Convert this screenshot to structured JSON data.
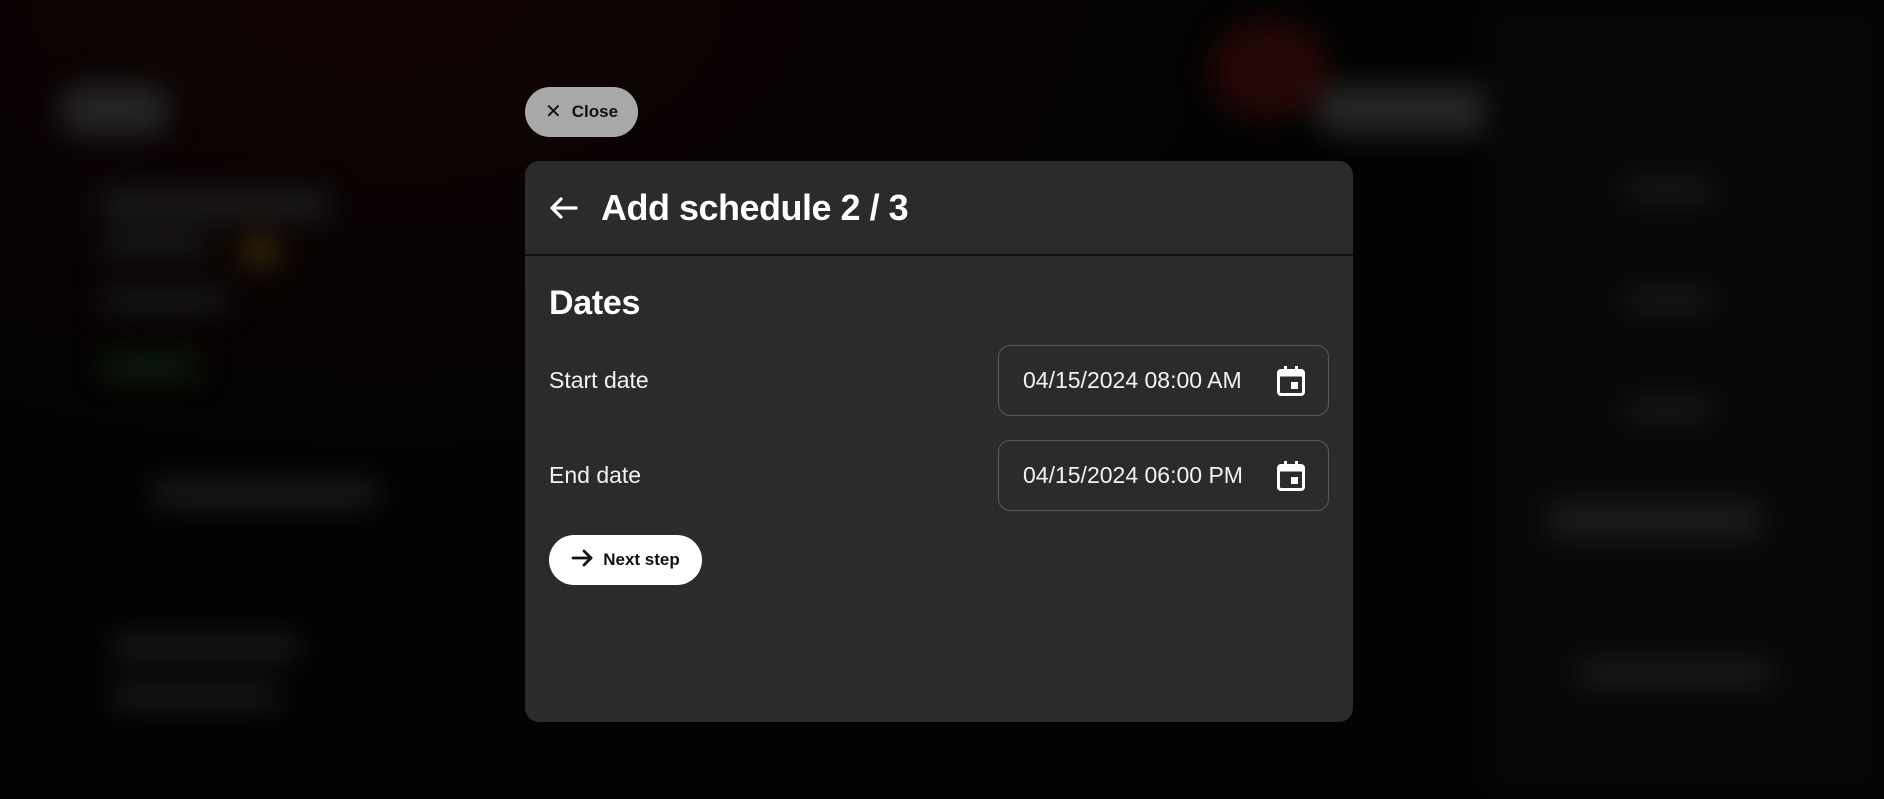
{
  "close_button": {
    "label": "Close",
    "icon": "close-icon"
  },
  "modal": {
    "title": "Add schedule 2 / 3",
    "back_icon": "arrow-left-icon",
    "section_title": "Dates",
    "fields": [
      {
        "label": "Start date",
        "value": "04/15/2024 08:00 AM",
        "icon": "calendar-icon"
      },
      {
        "label": "End date",
        "value": "04/15/2024 06:00 PM",
        "icon": "calendar-icon"
      }
    ],
    "next_button": {
      "label": "Next step",
      "icon": "arrow-right-icon"
    }
  },
  "colors": {
    "modal_bg": "#2b2b2b",
    "close_bg": "#a9a9a9",
    "next_bg": "#ffffff",
    "backdrop": "#050505"
  }
}
